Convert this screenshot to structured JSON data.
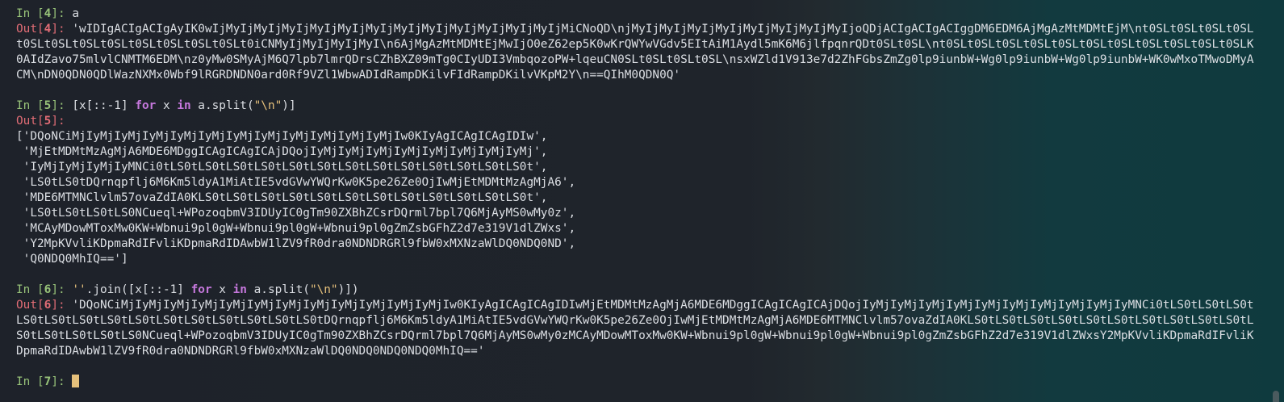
{
  "cells": [
    {
      "in_prompt": "In [",
      "in_num": "4",
      "in_close": "]: ",
      "code_plain": "a",
      "out_prompt": "Out[",
      "out_num": "4",
      "out_close": "]: ",
      "output": "'wIDIgACIgACIgAyIK0wIjMyIjMyIjMyIjMyIjMyIjMyIjMyIjMyIjMyIjMyIjMyIjMyIjMiCNoQD\\njMyIjMyIjMyIjMyIjMyIjMyIjMyIjMyIjoQDjACIgACIgACIggDM6EDM6AjMgAzMtMDMtEjM\\nt0SLt0SLt0SLt0SLt0SLt0SLt0SLt0SLt0SLt0SLt0SLt0SLt0iCNMyIjMyIjMyIjMyI\\n6AjMgAzMtMDMtEjMwIjO0eZ62ep5K0wKrQWYwVGdv5EItAiM1Aydl5mK6M6jlfpqnrQDt0SLt0SL\\nt0SLt0SLt0SLt0SLt0SLt0SLt0SLt0SLt0SLt0SLt0SLK0AIdZavo75mlvlCNMTM6EDM\\nz0yMw0SMyAjM6Q7lpb7lmrQDrsCZhBXZ09mTg0CIyUDI3VmbqozoPW+lqeuCN0SLt0SLt0SLt0SL\\nsxWZld1V913e7d2ZhFGbsZmZg0lp9iunbW+Wg0lp9iunbW+Wg0lp9iunbW+WK0wMxoTMwoDMyACM\\nDN0QDN0QDlWazNXMx0Wbf9lRGRDNDN0ard0Rf9VZl1WbwADIdRampDKilvFIdRampDKilvVKpM2Y\\n==QIhM0QDN0Q'"
    },
    {
      "in_prompt": "In [",
      "in_num": "5",
      "in_close": "]: ",
      "code_a": "[x[::-1] ",
      "code_kw1": "for",
      "code_b": " x ",
      "code_kw2": "in",
      "code_c": " a.split(",
      "code_str": "\"\\n\"",
      "code_d": ")]",
      "out_prompt": "Out[",
      "out_num": "5",
      "out_close": "]:",
      "list_lines": [
        "['DQoNCiMjIyMjIyMjIyMjIyMjIyMjIyMjIyMjIyMjIyMjIyMjIyMjIw0KIyAgICAgICAgIDIw',",
        " 'MjEtMDMtMzAgMjA6MDE6MDggICAgICAgICAjDQojIyMjIyMjIyMjIyMjIyMjIyMjIyMjIyMj',",
        " 'IyMjIyMjIyMjIyMNCi0tLS0tLS0tLS0tLS0tLS0tLS0tLS0tLS0tLS0tLS0tLS0tLS0tLS0t',",
        " 'LS0tLS0tDQrnqpflj6M6Km5ldyA1MiAtIE5vdGVwYWQrKw0K5pe26Ze0OjIwMjEtMDMtMzAgMjA6',",
        " 'MDE6MTMNClvlm57ovaZdIA0KLS0tLS0tLS0tLS0tLS0tLS0tLS0tLS0tLS0tLS0tLS0tLS0t',",
        " 'LS0tLS0tLS0tLS0NCueql+WPozoqbmV3IDUyIC0gTm90ZXBhZCsrDQrml7bpl7Q6MjAyMS0wMy0z',",
        " 'MCAyMDowMToxMw0KW+Wbnui9pl0gW+Wbnui9pl0gW+Wbnui9pl0gZmZsbGFhZ2d7e319V1dlZWxs',",
        " 'Y2MpKVvliKDpmaRdIFvliKDpmaRdIDAwbW1lZV9fR0dra0NDNDRGRl9fbW0xMXNzaWlDQ0NDQ0ND',",
        " 'Q0NDQ0MhIQ==']"
      ]
    },
    {
      "in_prompt": "In [",
      "in_num": "6",
      "in_close": "]: ",
      "code_str1": "''",
      "code_a": ".join([x[::-1] ",
      "code_kw1": "for",
      "code_b": " x ",
      "code_kw2": "in",
      "code_c": " a.split(",
      "code_str2": "\"\\n\"",
      "code_d": ")])",
      "out_prompt": "Out[",
      "out_num": "6",
      "out_close": "]: ",
      "output": "'DQoNCiMjIyMjIyMjIyMjIyMjIyMjIyMjIyMjIyMjIyMjIyMjIyMjIw0KIyAgICAgICAgIDIwMjEtMDMtMzAgMjA6MDE6MDggICAgICAgICAjDQojIyMjIyMjIyMjIyMjIyMjIyMjIyMjIyMjIyMjIyMNCi0tLS0tLS0tLS0tLS0tLS0tLS0tLS0tLS0tLS0tLS0tLS0tLS0tLS0tLS0tDQrnqpflj6M6Km5ldyA1MiAtIE5vdGVwYWQrKw0K5pe26Ze0OjIwMjEtMDMtMzAgMjA6MDE6MTMNClvlm57ovaZdIA0KLS0tLS0tLS0tLS0tLS0tLS0tLS0tLS0tLS0tLS0tLS0tLS0tLS0tLS0tLS0NCueql+WPozoqbmV3IDUyIC0gTm90ZXBhZCsrDQrml7bpl7Q6MjAyMS0wMy0zMCAyMDowMToxMw0KW+Wbnui9pl0gW+Wbnui9pl0gW+Wbnui9pl0gZmZsbGFhZ2d7e319V1dlZWxsY2MpKVvliKDpmaRdIFvliKDpmaRdIDAwbW1lZV9fR0dra0NDNDRGRl9fbW0xMXNzaWlDQ0NDQ0NDQ0NDQ0MhIQ=='"
    },
    {
      "in_prompt": "In [",
      "in_num": "7",
      "in_close": "]: "
    }
  ]
}
